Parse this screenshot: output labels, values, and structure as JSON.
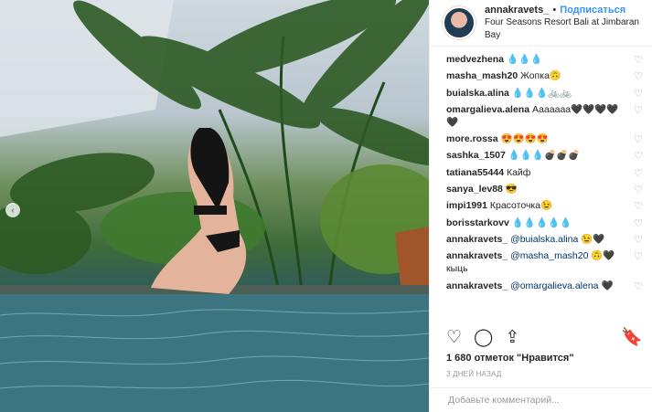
{
  "header": {
    "username": "annakravets_",
    "separator": "•",
    "follow_label": "Подписаться",
    "location": "Four Seasons Resort Bali at Jimbaran Bay"
  },
  "comments": [
    {
      "user": "medvezhena",
      "text": "💧💧💧"
    },
    {
      "user": "masha_mash20",
      "text": "Жопка🙃"
    },
    {
      "user": "buialska.alina",
      "text": "💧💧💧🚲🚲"
    },
    {
      "user": "omargalieva.alena",
      "text": "Ааааааа🖤🖤🖤🖤🖤"
    },
    {
      "user": "more.rossa",
      "text": "😍😍😍😍"
    },
    {
      "user": "sashka_1507",
      "text": "💧💧💧💣💣💣"
    },
    {
      "user": "tatiana55444",
      "text": "Кайф"
    },
    {
      "user": "sanya_lev88",
      "text": "😎"
    },
    {
      "user": "impi1991",
      "text": "Красоточка😉"
    },
    {
      "user": "borisstarkovv",
      "text": "💧💧💧💧💧"
    },
    {
      "user": "annakravets_",
      "mention": "@buialska.alina",
      "text": "😉🖤"
    },
    {
      "user": "annakravets_",
      "mention": "@masha_mash20",
      "text": "🙃🖤 кыць"
    },
    {
      "user": "annakravets_",
      "mention": "@omargalieva.alena",
      "text": "🖤"
    }
  ],
  "likes_text": "1 680 отметок \"Нравится\"",
  "time_text": "3 ДНЕЙ НАЗАД",
  "add_comment_placeholder": "Добавьте комментарий...",
  "icons": {
    "like": "♡",
    "comment": "◯",
    "share": "⇪",
    "bookmark": "🔖",
    "comment_like": "♡",
    "carousel_prev": "‹"
  }
}
